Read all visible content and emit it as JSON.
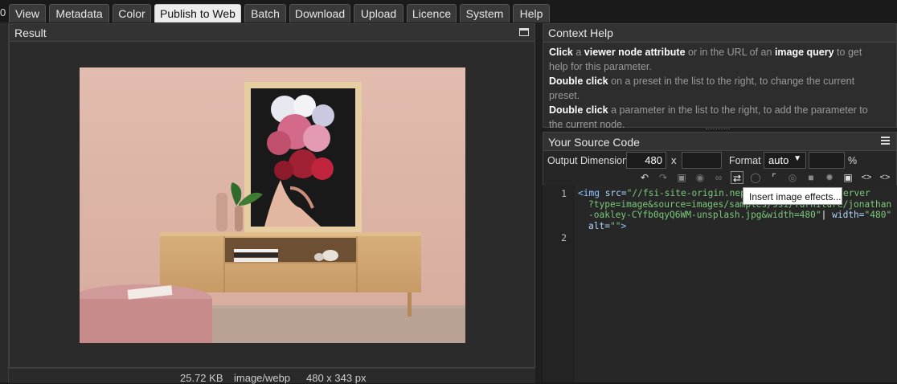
{
  "tabs": [
    {
      "label": "View",
      "active": false
    },
    {
      "label": "Metadata",
      "active": false
    },
    {
      "label": "Color",
      "active": false
    },
    {
      "label": "Publish to Web",
      "active": true
    },
    {
      "label": "Batch",
      "active": false
    },
    {
      "label": "Download",
      "active": false
    },
    {
      "label": "Upload",
      "active": false
    },
    {
      "label": "Licence",
      "active": false
    },
    {
      "label": "System",
      "active": false
    },
    {
      "label": "Help",
      "active": false
    }
  ],
  "edge_glyph": "0",
  "result": {
    "title": "Result",
    "size": "25.72 KB",
    "format": "image/webp",
    "dimensions": "480 x 343 px"
  },
  "context_help": {
    "title": "Context Help",
    "line1": {
      "b1": "Click",
      "t1": " a ",
      "b2": "viewer node attribute",
      "t2": " or in the URL of an ",
      "b3": "image query",
      "t3": " to get help for this parameter."
    },
    "line2": {
      "b1": "Double click",
      "t1": " on a preset in the list to the right, to change the current preset."
    },
    "line3": {
      "b1": "Double click",
      "t1": " a parameter in the list to the right, to add the parameter to the current node."
    }
  },
  "source_code": {
    "title": "Your Source Code",
    "output_dimension_label": "Output Dimension",
    "width_value": "480",
    "x_label": "x",
    "height_value": "",
    "format_label": "Format",
    "format_value": "auto",
    "quality_value": "",
    "percent_label": "%",
    "line_numbers": [
      "1",
      "2"
    ],
    "code": {
      "l1_tag": "<img",
      "l1_attr": " src=",
      "l1_val": "\"//fsi-site-origin.neptunelabs.com/fsi/server",
      "l2_val": "?type=image&source=images/samples/ssi/furniture/jonathan",
      "l3_val": "-oakley-CYfb0qyQ6WM-unsplash.jpg&width=480\"",
      "l3_attr": " width=",
      "l3_attrval": "\"480\"",
      "l4_attr": "alt=",
      "l4_val": "\"\"",
      "l4_end": ">"
    },
    "tooltip": "Insert image effects..."
  },
  "icons": [
    "undo-icon",
    "redo-icon",
    "crop-image-icon",
    "preset-icon",
    "link-icon",
    "effects-icon",
    "clear-crop-icon",
    "crop-icon",
    "camera-icon",
    "folder-icon",
    "settings-icon",
    "code-icon",
    "code-tag-icon",
    "code-brackets-icon",
    "menu-icon",
    "maximize-icon"
  ]
}
